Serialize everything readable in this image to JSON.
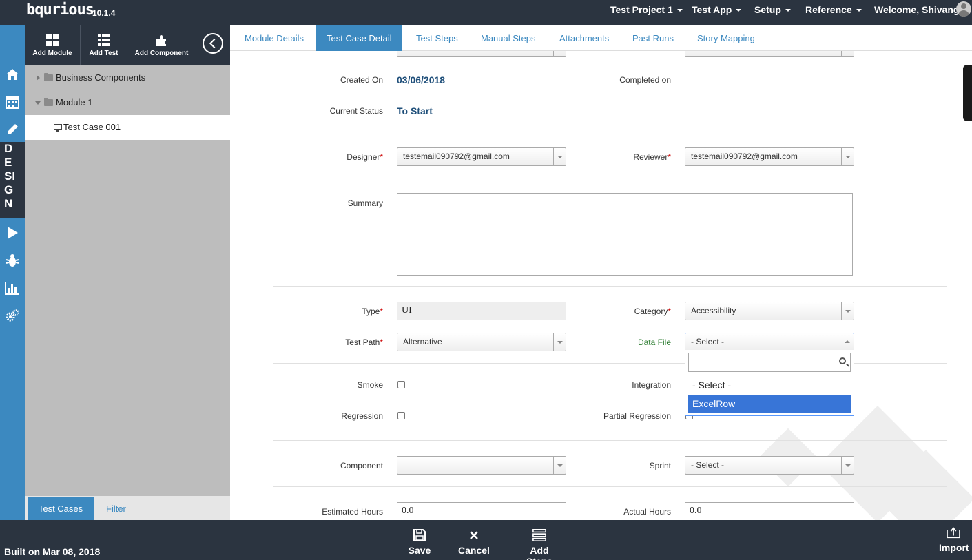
{
  "app": {
    "logo": "bqurious",
    "version": "10.1.4"
  },
  "topnav": {
    "project": "Test Project 1",
    "app": "Test App",
    "setup": "Setup",
    "reference": "Reference",
    "welcome": "Welcome, Shivangi"
  },
  "rail": {
    "design_letters": [
      "D",
      "E",
      "SI",
      "G",
      "N"
    ]
  },
  "sidebar": {
    "tools": {
      "add_module": "Add Module",
      "add_test": "Add Test",
      "add_component": "Add Component"
    },
    "tree": {
      "business_components": "Business Components",
      "module1": "Module 1",
      "test_case": "Test Case 001"
    },
    "bottom_tabs": {
      "test_cases": "Test Cases",
      "filter": "Filter"
    }
  },
  "tabs": [
    "Module Details",
    "Test Case Detail",
    "Test Steps",
    "Manual Steps",
    "Attachments",
    "Past Runs",
    "Story Mapping"
  ],
  "active_tab": "Test Case Detail",
  "form": {
    "created_on_label": "Created On",
    "created_on_value": "03/06/2018",
    "completed_on_label": "Completed on",
    "current_status_label": "Current Status",
    "current_status_value": "To Start",
    "designer_label": "Designer",
    "designer_value": "testemail090792@gmail.com",
    "reviewer_label": "Reviewer",
    "reviewer_value": "testemail090792@gmail.com",
    "summary_label": "Summary",
    "type_label": "Type",
    "type_value": "UI",
    "category_label": "Category",
    "category_value": "Accessibility",
    "test_path_label": "Test Path",
    "test_path_value": "Alternative",
    "data_file_label": "Data File",
    "data_file_value": "- Select -",
    "data_file_options": [
      "- Select -",
      "ExcelRow"
    ],
    "data_file_highlighted": "ExcelRow",
    "smoke_label": "Smoke",
    "integration_label": "Integration",
    "regression_label": "Regression",
    "partial_regression_label": "Partial Regression",
    "component_label": "Component",
    "component_value": "",
    "sprint_label": "Sprint",
    "sprint_value": "- Select -",
    "estimated_hours_label": "Estimated Hours",
    "estimated_hours_value": "0.0",
    "actual_hours_label": "Actual Hours",
    "actual_hours_value": "0.0"
  },
  "bottombar": {
    "built": "Built on Mar 08, 2018",
    "save": "Save",
    "cancel": "Cancel",
    "add_steps": "Add Steps",
    "import": "Import"
  },
  "colors": {
    "brand_dark": "#2b3440",
    "brand_blue": "#3c89c0",
    "dropdown_highlight": "#3875d7",
    "required": "#cc0000"
  }
}
